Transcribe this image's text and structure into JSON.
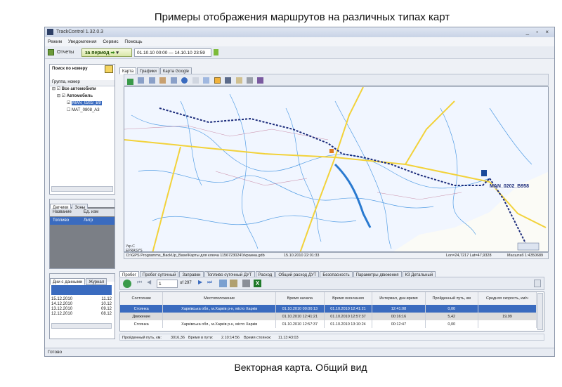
{
  "slide": {
    "title": "Примеры отображения маршрутов на различных типах карт",
    "caption": "Векторная карта. Общий вид"
  },
  "window": {
    "title": "TrackControl 1.32.0.3",
    "controls": "_ ▫ ×"
  },
  "menu": [
    "Режим",
    "Уведомления",
    "Сервис",
    "Помощь"
  ],
  "toolbar": {
    "reports_label": "Отчеты",
    "period_label": "за период",
    "date_range": "01.10.10  00:00  —  14.10.10  23:59"
  },
  "left_panel": {
    "search_label": "Поиск по номеру",
    "tree_header": "Группа, номер",
    "tree": [
      {
        "label": "Все автомобили",
        "bold": true
      },
      {
        "label": "Автомобиль",
        "bold": true
      },
      {
        "label": "MAN_0202_B9",
        "selected": true
      },
      {
        "label": "MAT_0808_A3"
      }
    ],
    "sensor_tabs": [
      "Датчики",
      "Зоны"
    ],
    "sensor_headers": [
      "Название",
      "Ед. изм"
    ],
    "sensor_rows": [
      [
        "Топливо",
        "Литр"
      ]
    ],
    "log_tabs": [
      "Дни с данными",
      "Журнал"
    ],
    "dates": [
      [
        "15.12.2010",
        "11.12"
      ],
      [
        "14.12.2010",
        "10.12"
      ],
      [
        "13.12.2010",
        "09.12"
      ],
      [
        "12.12.2010",
        "08.12"
      ]
    ]
  },
  "map_tabs": [
    "Карта",
    "Графики",
    "Карта Google"
  ],
  "map": {
    "vehicle_label": "MAN_0202_B958",
    "legend_text": "Укр.С\nEPRASYS",
    "status_path": "D:\\GPS Programms_BackUp_Base\\Карты для ключа 1156723024\\Украина.gdb",
    "status_date": "15.10.2010 22:01:33",
    "status_coords": "Lon=24,7217 Lat=47,9328",
    "status_scale": "Масштаб 1:4350689"
  },
  "report_tabs": [
    "Пробег",
    "Пробег суточный",
    "Заправки",
    "Топливо суточный ДУТ",
    "Расход",
    "Общий расход ДУТ",
    "Безопасность",
    "Параметры движения",
    "КЗ Детальный"
  ],
  "pager": {
    "page": "1",
    "of": "of 297"
  },
  "table": {
    "headers": [
      "Состояние",
      "Местоположение",
      "Время начала",
      "Время окончания",
      "Интервал, дни.время",
      "Пройденный путь, км",
      "Средняя скорость, км/ч"
    ],
    "rows": [
      [
        "Стоянка",
        "Харківська обл., м.Харків р-н, місто Харків",
        "01.10.2010 00:00:13",
        "01.10.2010 12:41:21",
        "12:41:08",
        "0,00",
        ""
      ],
      [
        "Движение",
        "",
        "01.10.2010 12:41:21",
        "01.10.2010 12:57:37",
        "00:16:16",
        "5,42",
        "19,99"
      ],
      [
        "Стоянка",
        "Харківська обл., м.Харків р-н, місто Харків",
        "01.10.2010 12:57:37",
        "01.10.2010 13:10:24",
        "00:12:47",
        "0,00",
        ""
      ]
    ]
  },
  "summary": {
    "distance_label": "Пройденный путь, км:",
    "distance_value": "3016,36",
    "travel_label": "Время в пути:",
    "travel_value": "2.10:14:56",
    "stops_label": "Время стоянок:",
    "stops_value": "11.13:43:03"
  },
  "statusbar": "Готово",
  "colors": {
    "route": "#1a2a7a",
    "road": "#f2d23a",
    "river": "#3a8fe0",
    "selection": "#3a6bbf"
  }
}
